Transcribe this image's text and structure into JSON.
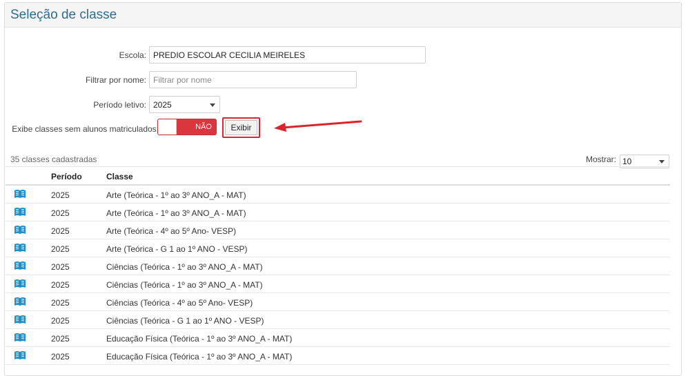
{
  "page": {
    "title": "Seleção de classe"
  },
  "form": {
    "escola_label": "Escola:",
    "escola_value": "PREDIO ESCOLAR CECILIA MEIRELES",
    "filtro_label": "Filtrar por nome:",
    "filtro_placeholder": "Filtrar por nome",
    "periodo_label": "Período letivo:",
    "periodo_value": "2025",
    "exibe_label": "Exibe classes sem alunos matriculados:",
    "toggle_text": "NÃO",
    "exibir_button": "Exibir"
  },
  "list": {
    "count_text": "35 classes cadastradas",
    "mostrar_label": "Mostrar:",
    "mostrar_value": "10",
    "columns": [
      "Período",
      "Classe"
    ],
    "rows": [
      {
        "periodo": "2025",
        "classe": "Arte (Teórica - 1º ao 3º ANO_A - MAT)"
      },
      {
        "periodo": "2025",
        "classe": "Arte (Teórica - 1º ao 3º ANO_A - MAT)"
      },
      {
        "periodo": "2025",
        "classe": "Arte (Teórica - 4º ao 5º Ano- VESP)"
      },
      {
        "periodo": "2025",
        "classe": "Arte (Teórica - G 1 ao 1º ANO - VESP)"
      },
      {
        "periodo": "2025",
        "classe": "Ciências (Teórica - 1º ao 3º ANO_A - MAT)"
      },
      {
        "periodo": "2025",
        "classe": "Ciências (Teórica - 1º ao 3º ANO_A - MAT)"
      },
      {
        "periodo": "2025",
        "classe": "Ciências (Teórica - 4º ao 5º Ano- VESP)"
      },
      {
        "periodo": "2025",
        "classe": "Ciências (Teórica - G 1 ao 1º ANO - VESP)"
      },
      {
        "periodo": "2025",
        "classe": "Educação Física (Teórica - 1º ao 3º ANO_A - MAT)"
      },
      {
        "periodo": "2025",
        "classe": "Educação Física (Teórica - 1º ao 3º ANO_A - MAT)"
      }
    ]
  },
  "colors": {
    "title": "#2f6b93",
    "toggle_off": "#d9363e",
    "highlight": "#d9262e",
    "book_icon": "#1f8fc9"
  },
  "icons": {
    "row_icon": "open-book-icon",
    "annotation": "arrow-icon"
  }
}
